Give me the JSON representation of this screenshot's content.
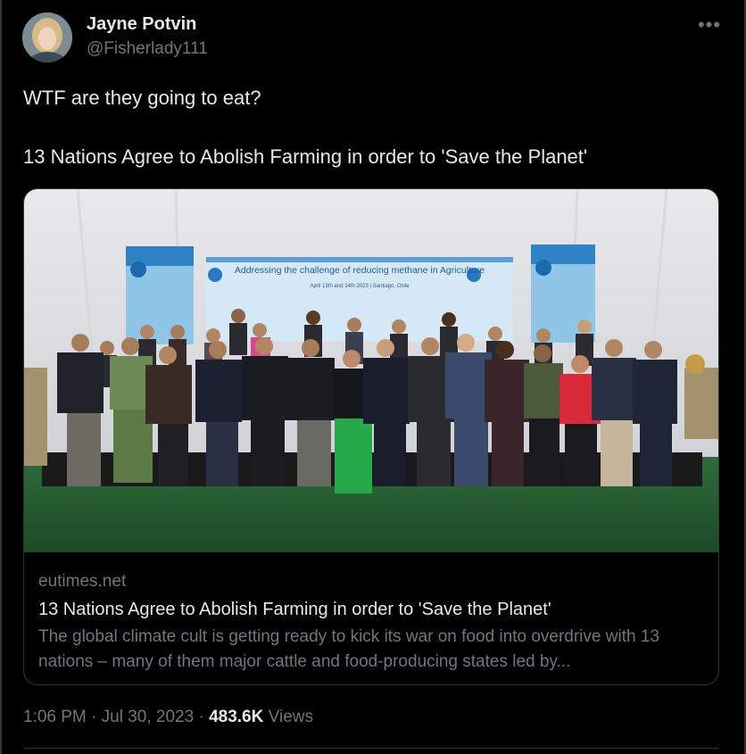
{
  "author": {
    "name": "Jayne Potvin",
    "handle": "@Fisherlady111",
    "avatar_icon": "profile-photo"
  },
  "tweet": {
    "line1": "WTF are they going to eat?",
    "line2": "13 Nations Agree to Abolish Farming in order to 'Save the Planet'"
  },
  "card": {
    "image_banner_text": "Addressing the challenge of reducing methane in Agriculture",
    "image_banner_subtext": "April 13th and 14th 2023 | Santiago, Chile",
    "domain": "eutimes.net",
    "title": "13 Nations Agree to Abolish Farming in order to 'Save the Planet'",
    "description": "The global climate cult is getting ready to kick its war on food into overdrive with 13 nations – many of them major cattle and food-producing states led by..."
  },
  "meta": {
    "time": "1:06 PM",
    "separator": " · ",
    "date": "Jul 30, 2023",
    "views_count": "483.6K",
    "views_label": " Views"
  },
  "more_icon": "more-horizontal-icon",
  "more_glyph": "•••",
  "colors": {
    "background": "#000000",
    "text_primary": "#e7e9ea",
    "text_secondary": "#71767b",
    "border": "#2f3336"
  }
}
